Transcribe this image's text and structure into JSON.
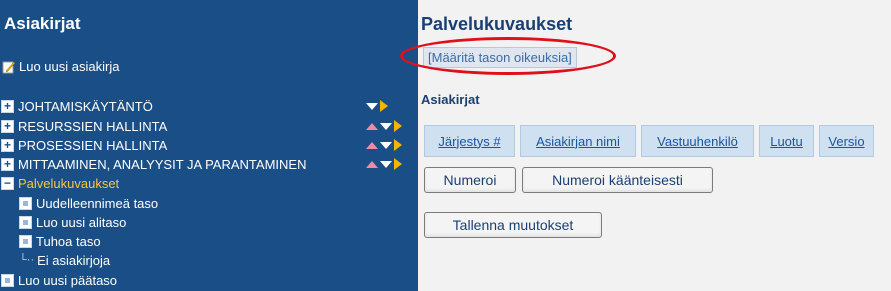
{
  "left": {
    "title": "Asiakirjat",
    "new_doc": "Luo uusi asiakirja",
    "tree": [
      {
        "label": "JOHTAMISKÄYTÄNTÖ",
        "state": "+"
      },
      {
        "label": "RESURSSIEN HALLINTA",
        "state": "+"
      },
      {
        "label": "PROSESSIEN HALLINTA",
        "state": "+"
      },
      {
        "label": "MITTAAMINEN, ANALYYSIT JA PARANTAMINEN",
        "state": "+"
      },
      {
        "label": "Palvelukuvaukset",
        "state": "−"
      }
    ],
    "sub": [
      "Uudelleennimeä taso",
      "Luo uusi alitaso",
      "Tuhoa taso",
      "Ei asiakirjoja"
    ],
    "new_top": "Luo uusi päätaso"
  },
  "right": {
    "title": "Palvelukuvaukset",
    "perm_link": "[Määritä tason oikeuksia]",
    "docs_label": "Asiakirjat",
    "columns": [
      "Järjestys #",
      "Asiakirjan nimi",
      "Vastuuhenkilö",
      "Luotu",
      "Versio"
    ],
    "btn_number": "Numeroi",
    "btn_reverse": "Numeroi käänteisesti",
    "btn_save": "Tallenna muutokset"
  },
  "colors": {
    "sidebar": "#1a4e86",
    "highlight": "#f7c843",
    "annotation": "#e0101a"
  }
}
